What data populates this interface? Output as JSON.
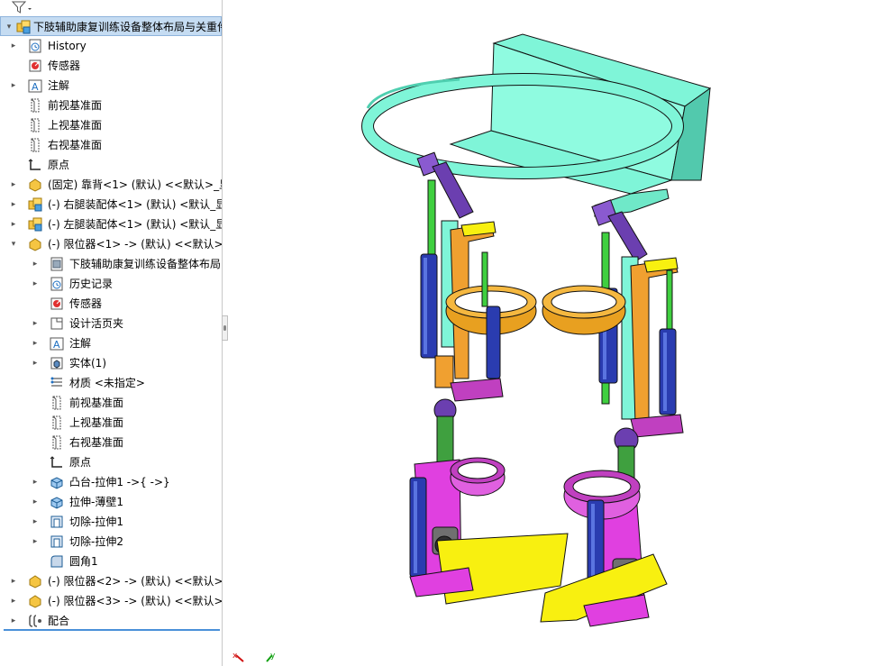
{
  "tree": {
    "root": "下肢辅助康复训练设备整体布局与关重件",
    "items": [
      {
        "label": "History",
        "icon": "history-icon",
        "toggle": "▸",
        "indent": 0
      },
      {
        "label": "传感器",
        "icon": "sensor-icon",
        "toggle": "",
        "indent": 0
      },
      {
        "label": "注解",
        "icon": "annotation-icon",
        "toggle": "▸",
        "indent": 0
      },
      {
        "label": "前视基准面",
        "icon": "plane-icon",
        "toggle": "",
        "indent": 0
      },
      {
        "label": "上视基准面",
        "icon": "plane-icon",
        "toggle": "",
        "indent": 0
      },
      {
        "label": "右视基准面",
        "icon": "plane-icon",
        "toggle": "",
        "indent": 0
      },
      {
        "label": "原点",
        "icon": "origin-icon",
        "toggle": "",
        "indent": 0
      },
      {
        "label": "(固定) 靠背<1> (默认) <<默认>_显",
        "icon": "part-icon",
        "toggle": "▸",
        "indent": 0
      },
      {
        "label": "(-) 右腿装配体<1> (默认) <默认_显",
        "icon": "assembly-icon",
        "toggle": "▸",
        "indent": 0
      },
      {
        "label": "(-) 左腿装配体<1> (默认) <默认_显",
        "icon": "assembly-icon",
        "toggle": "▸",
        "indent": 0
      },
      {
        "label": "(-) 限位器<1> -> (默认) <<默认>_",
        "icon": "part-icon",
        "toggle": "▾",
        "indent": 0
      },
      {
        "label": "下肢辅助康复训练设备整体布局",
        "icon": "doc-icon",
        "toggle": "▸",
        "indent": 1
      },
      {
        "label": "历史记录",
        "icon": "history-icon",
        "toggle": "▸",
        "indent": 1
      },
      {
        "label": "传感器",
        "icon": "sensor-icon",
        "toggle": "",
        "indent": 1
      },
      {
        "label": "设计活页夹",
        "icon": "binder-icon",
        "toggle": "▸",
        "indent": 1
      },
      {
        "label": "注解",
        "icon": "annotation-icon",
        "toggle": "▸",
        "indent": 1
      },
      {
        "label": "实体(1)",
        "icon": "solid-body-icon",
        "toggle": "▸",
        "indent": 1
      },
      {
        "label": "材质 <未指定>",
        "icon": "material-icon",
        "toggle": "",
        "indent": 1
      },
      {
        "label": "前视基准面",
        "icon": "plane-icon",
        "toggle": "",
        "indent": 1
      },
      {
        "label": "上视基准面",
        "icon": "plane-icon",
        "toggle": "",
        "indent": 1
      },
      {
        "label": "右视基准面",
        "icon": "plane-icon",
        "toggle": "",
        "indent": 1
      },
      {
        "label": "原点",
        "icon": "origin-icon",
        "toggle": "",
        "indent": 1
      },
      {
        "label": "凸台-拉伸1 ->{ ->}",
        "icon": "extrude-icon",
        "toggle": "▸",
        "indent": 1
      },
      {
        "label": "拉伸-薄壁1",
        "icon": "extrude-icon",
        "toggle": "▸",
        "indent": 1
      },
      {
        "label": "切除-拉伸1",
        "icon": "cut-icon",
        "toggle": "▸",
        "indent": 1
      },
      {
        "label": "切除-拉伸2",
        "icon": "cut-icon",
        "toggle": "▸",
        "indent": 1
      },
      {
        "label": "圆角1",
        "icon": "fillet-icon",
        "toggle": "",
        "indent": 1
      },
      {
        "label": "(-) 限位器<2> -> (默认) <<默认>_",
        "icon": "part-icon",
        "toggle": "▸",
        "indent": 0
      },
      {
        "label": "(-) 限位器<3> -> (默认) <<默认>_",
        "icon": "part-icon",
        "toggle": "▸",
        "indent": 0
      },
      {
        "label": "配合",
        "icon": "mates-icon",
        "toggle": "▸",
        "indent": 0
      }
    ]
  },
  "triad": {
    "x_label": "x",
    "y_label": "y"
  },
  "colors": {
    "backrest": "#7ff5d8",
    "thigh_cuff": "#e8a020",
    "shank_cuff": "#d040d0",
    "foot_plate": "#f8f010",
    "actuator": "#2a3cb0",
    "link_green": "#40c040",
    "selection": "#c5dcf2"
  }
}
